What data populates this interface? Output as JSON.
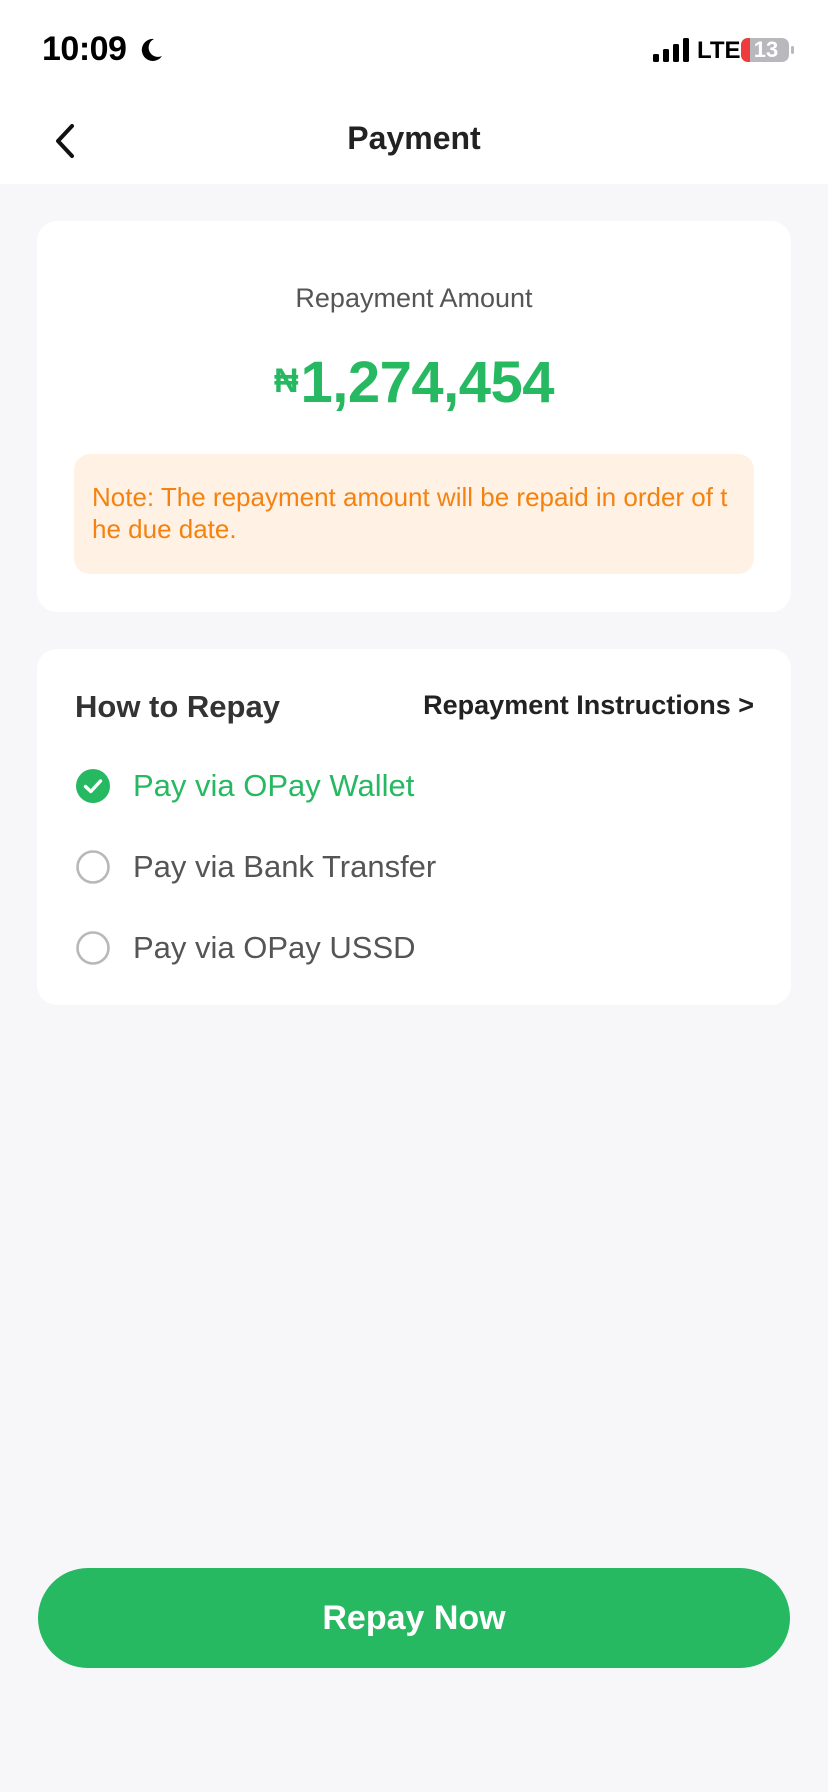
{
  "status_bar": {
    "time": "10:09",
    "network": "LTE",
    "battery": "13",
    "icons": [
      "moon-icon",
      "signal-icon",
      "battery-icon"
    ]
  },
  "nav": {
    "title": "Payment",
    "back_icon": "chevron-left-icon"
  },
  "amount_card": {
    "label": "Repayment Amount",
    "currency_symbol": "₦",
    "amount": "1,274,454",
    "note": "Note: The repayment amount will be repaid in order of the due date."
  },
  "repay_section": {
    "title": "How to Repay",
    "instructions_link": "Repayment Instructions >",
    "options": [
      {
        "label": "Pay via OPay Wallet",
        "selected": true
      },
      {
        "label": "Pay via Bank Transfer",
        "selected": false
      },
      {
        "label": "Pay via OPay USSD",
        "selected": false
      }
    ]
  },
  "primary_action": {
    "label": "Repay Now"
  },
  "colors": {
    "brand_green": "#27b862",
    "note_background": "#fff1e4",
    "note_text": "#f5820f",
    "page_background": "#f7f7f9"
  }
}
